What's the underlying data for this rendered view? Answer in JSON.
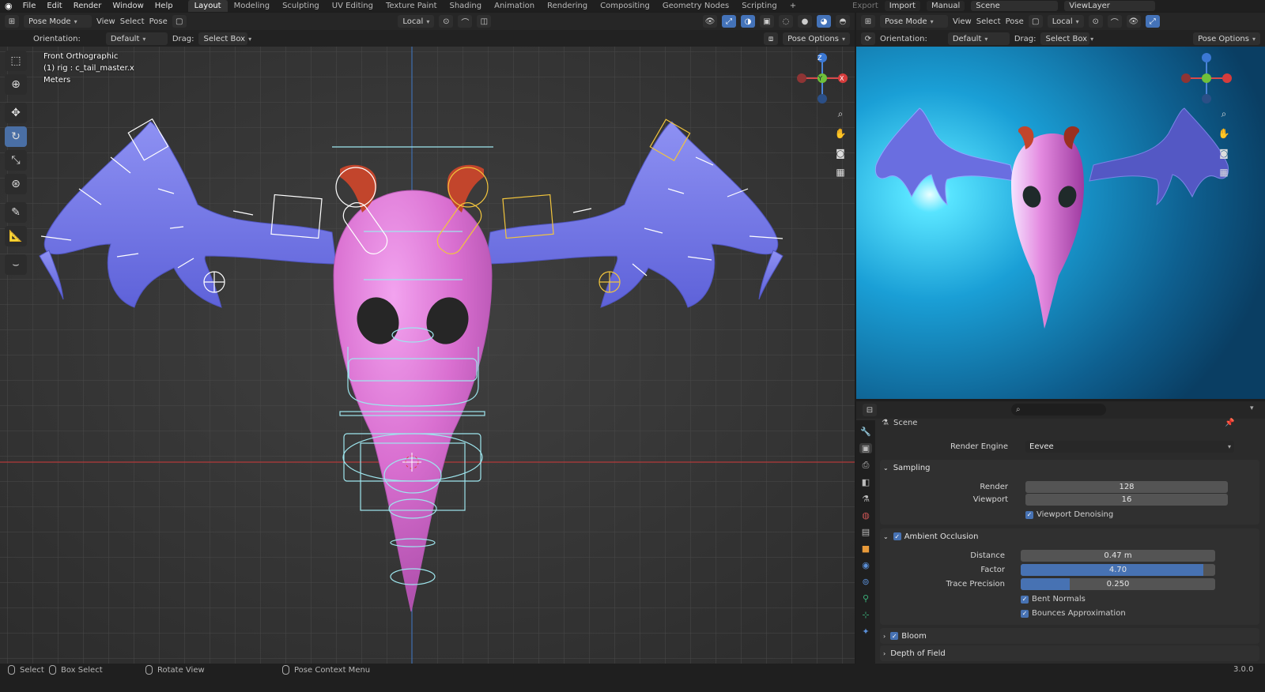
{
  "topbar": {
    "menus": [
      "File",
      "Edit",
      "Render",
      "Window",
      "Help"
    ],
    "workspaces": [
      "Layout",
      "Modeling",
      "Sculpting",
      "UV Editing",
      "Texture Paint",
      "Shading",
      "Animation",
      "Rendering",
      "Compositing",
      "Geometry Nodes",
      "Scripting"
    ],
    "active_workspace": "Layout",
    "add_tab": "+",
    "export_label": "Export",
    "import_label": "Import",
    "manual_label": "Manual",
    "scene_label": "Scene",
    "viewlayer_label": "ViewLayer"
  },
  "viewport_header": {
    "mode": "Pose Mode",
    "menus": [
      "View",
      "Select",
      "Pose"
    ],
    "transform": "Local",
    "orientation_label": "Orientation:",
    "orientation_value": "Default",
    "drag_label": "Drag:",
    "drag_value": "Select Box",
    "pose_options": "Pose Options"
  },
  "viewport": {
    "view_name": "Front Orthographic",
    "selection": "(1) rig : c_tail_master.x",
    "units": "Meters",
    "axes": {
      "z": "Z",
      "y": "Y",
      "x": "X"
    }
  },
  "render_header": {
    "mode": "Pose Mode",
    "menus": [
      "View",
      "Select",
      "Pose"
    ],
    "transform": "Local",
    "orientation_label": "Orientation:",
    "orientation_value": "Default",
    "drag_label": "Drag:",
    "drag_value": "Select Box",
    "pose_options": "Pose Options"
  },
  "properties": {
    "search_placeholder": "",
    "context": "Scene",
    "render_engine_label": "Render Engine",
    "render_engine_value": "Eevee",
    "sampling": {
      "title": "Sampling",
      "render_label": "Render",
      "render_value": "128",
      "viewport_label": "Viewport",
      "viewport_value": "16",
      "denoise_label": "Viewport Denoising"
    },
    "ao": {
      "title": "Ambient Occlusion",
      "distance_label": "Distance",
      "distance_value": "0.47 m",
      "factor_label": "Factor",
      "factor_value": "4.70",
      "factor_fill": 0.94,
      "trace_label": "Trace Precision",
      "trace_value": "0.250",
      "trace_fill": 0.25,
      "bent_normals": "Bent Normals",
      "bounces": "Bounces Approximation"
    },
    "bloom": "Bloom",
    "dof": "Depth of Field"
  },
  "status": {
    "select": "Select",
    "box_select": "Box Select",
    "rotate_view": "Rotate View",
    "context_menu": "Pose Context Menu",
    "version": "3.0.0"
  },
  "colors": {
    "accent": "#4772b3",
    "body_pink": "#d96fd0",
    "wing_blue": "#6f73e6",
    "horn": "#c2452c",
    "render_bg": "#1a9fd6"
  }
}
